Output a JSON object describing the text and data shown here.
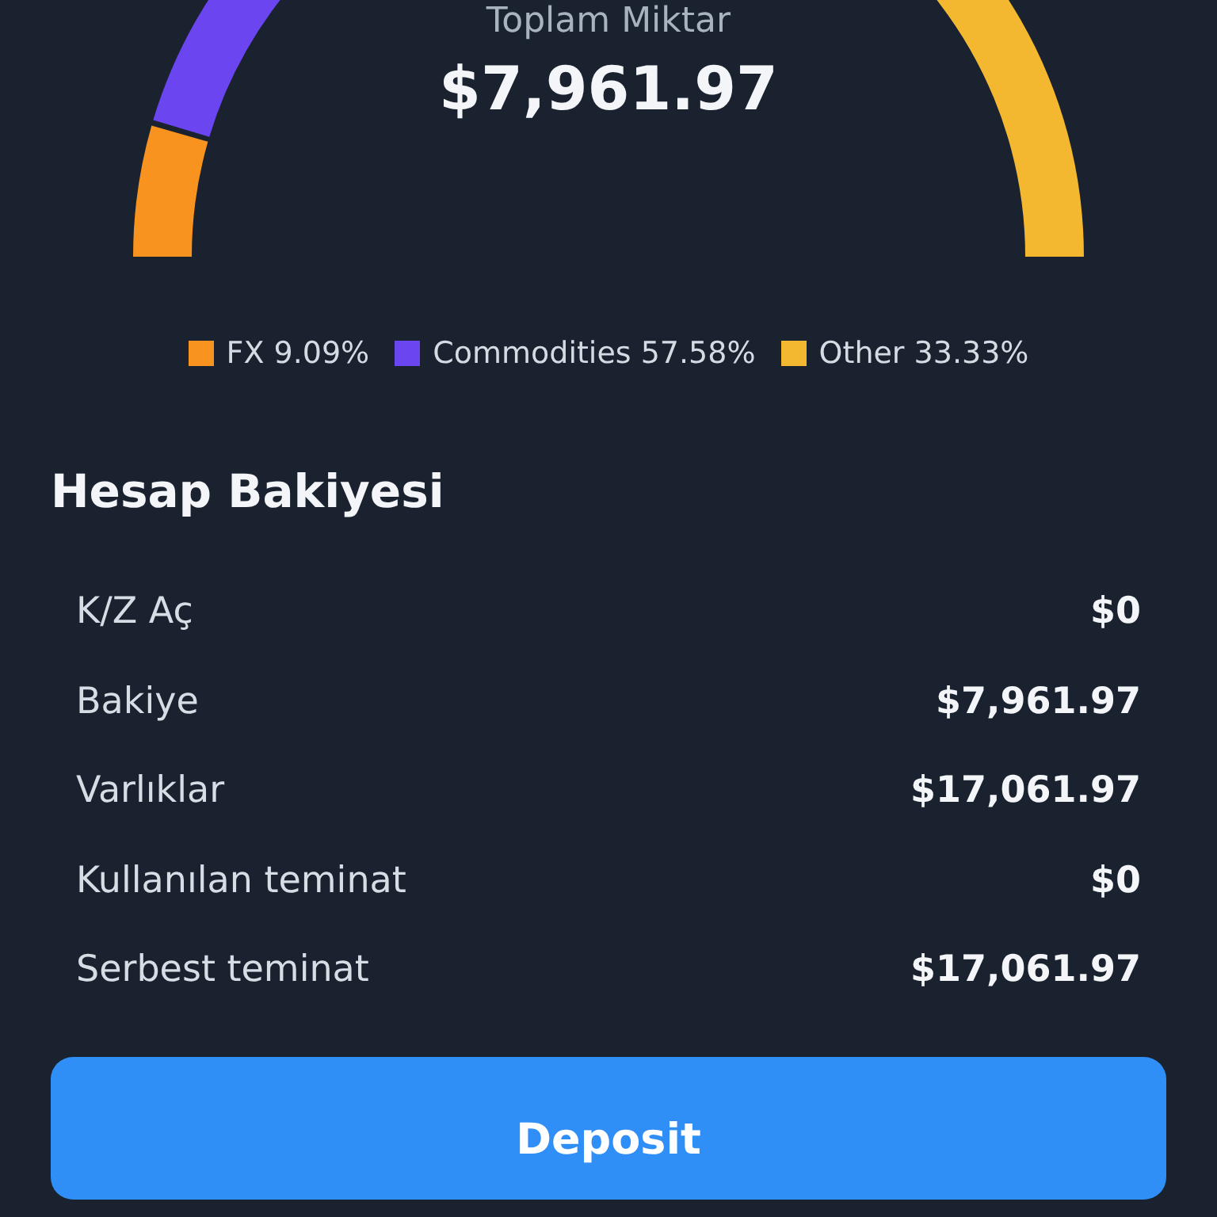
{
  "gauge": {
    "title": "Toplam Miktar",
    "total": "$7,961.97",
    "chart_data": {
      "type": "donut",
      "categories": [
        "FX",
        "Commodities",
        "Other"
      ],
      "values": [
        9.09,
        57.58,
        33.33
      ]
    },
    "legend": [
      {
        "value": "9.09%",
        "color": "#f7931e"
      },
      {
        "value": "57.58%",
        "color": "#6a45f0"
      },
      {
        "value": "33.33%",
        "color": "#f3b82f"
      }
    ]
  },
  "balance": {
    "title": "Hesap Bakiyesi",
    "rows": [
      {
        "label": "K/Z Aç",
        "value": "$0"
      },
      {
        "label": "Bakiye",
        "value": "$7,961.97"
      },
      {
        "label": "Varlıklar",
        "value": "$17,061.97"
      },
      {
        "label": "Kullanılan teminat",
        "value": "$0"
      },
      {
        "label": "Serbest teminat",
        "value": "$17,061.97"
      }
    ]
  },
  "button": {
    "label": "Deposit"
  }
}
